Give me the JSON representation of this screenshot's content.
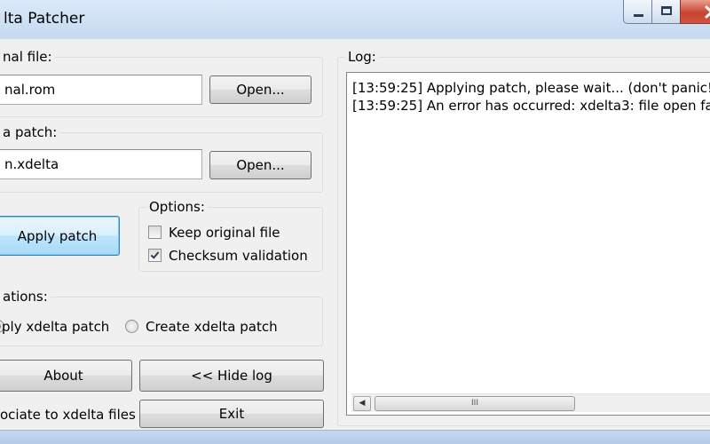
{
  "window": {
    "title": "lta Patcher",
    "controls": {
      "minimize": "minimize-icon",
      "maximize": "maximize-icon",
      "close": "close-icon"
    }
  },
  "original_file": {
    "group_label": "nal file:",
    "value": "nal.rom",
    "open_label": "Open..."
  },
  "patch_file": {
    "group_label": "a patch:",
    "value": "n.xdelta",
    "open_label": "Open..."
  },
  "apply_label": "Apply patch",
  "options": {
    "group_label": "Options:",
    "keep_original": {
      "label": "Keep original file",
      "checked": false
    },
    "checksum": {
      "label": "Checksum validation",
      "checked": true
    }
  },
  "operations": {
    "group_label": "ations:",
    "apply": {
      "label": "ply xdelta patch",
      "selected": true
    },
    "create": {
      "label": "Create xdelta patch",
      "selected": false
    }
  },
  "buttons": {
    "about": "About",
    "hide_log": "<< Hide log",
    "associate": "ociate to xdelta files",
    "exit": "Exit"
  },
  "log": {
    "label": "Log:",
    "lines": [
      "[13:59:25] Applying patch, please wait... (don't panic!)",
      "[13:59:25] An error has occurred: xdelta3: file open fa"
    ],
    "scroll_grip": "III"
  },
  "colors": {
    "titlebar": "#c9dcf1",
    "client_bg": "#f0f0f0",
    "focus_button_border": "#3c7fb1",
    "radio_dot": "#2c8a1d"
  }
}
